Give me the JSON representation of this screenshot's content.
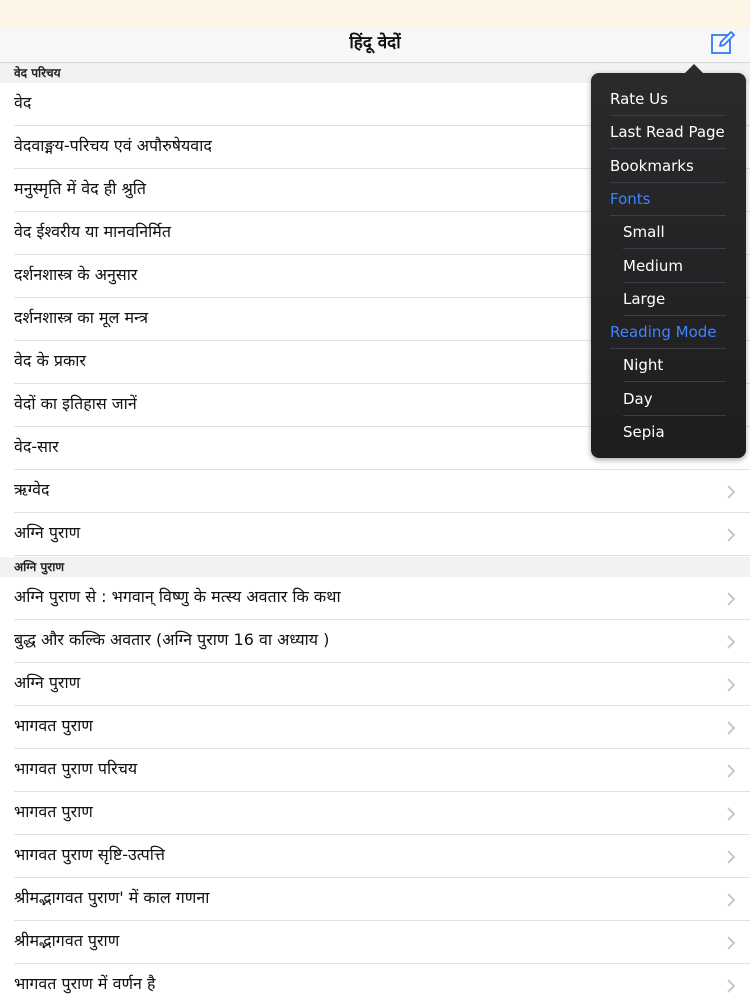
{
  "nav": {
    "title": "हिंदू वेदों",
    "compose_icon": "compose-icon"
  },
  "sections": [
    {
      "header": "वेद परिचय",
      "items": [
        "वेद",
        "वेदवाङ्मय-परिचय एवं अपौरुषेयवाद",
        "मनुस्मृति में वेद ही श्रुति",
        "वेद ईश्वरीय या मानवनिर्मित",
        "दर्शनशास्त्र के अनुसार",
        "दर्शनशास्त्र का मूल मन्त्र",
        "वेद के प्रकार",
        "वेदों का इतिहास जानें",
        "वेद-सार",
        "ऋग्वेद",
        "अग्नि पुराण"
      ]
    },
    {
      "header": "अग्नि पुराण",
      "items": [
        "अग्नि पुराण से : भगवान् विष्णु के मत्स्य अवतार कि कथा",
        "बुद्ध और कल्कि अवतार (अग्नि पुराण 16 वा अध्याय )",
        "अग्नि पुराण",
        "भागवत पुराण",
        "भागवत पुराण परिचय",
        "भागवत पुराण",
        "भागवत पुराण सृष्टि-उत्पत्ति",
        "श्रीमद्भागवत पुराण' में काल गणना",
        "श्रीमद्भागवत पुराण",
        "भागवत पुराण में वर्णन है"
      ]
    }
  ],
  "menu": {
    "items": [
      {
        "label": "Rate Us",
        "type": "action"
      },
      {
        "label": "Last Read Page",
        "type": "action"
      },
      {
        "label": "Bookmarks",
        "type": "action"
      },
      {
        "label": "Fonts",
        "type": "header"
      },
      {
        "label": "Small",
        "type": "option"
      },
      {
        "label": "Medium",
        "type": "option"
      },
      {
        "label": "Large",
        "type": "option"
      },
      {
        "label": "Reading Mode",
        "type": "header"
      },
      {
        "label": "Night",
        "type": "option"
      },
      {
        "label": "Day",
        "type": "option"
      },
      {
        "label": "Sepia",
        "type": "option"
      }
    ]
  },
  "colors": {
    "accent": "#3d84ff",
    "menu_background": "#1e1e20",
    "chevron": "#c7c7cc",
    "compose_icon": "#2f7cf6"
  }
}
